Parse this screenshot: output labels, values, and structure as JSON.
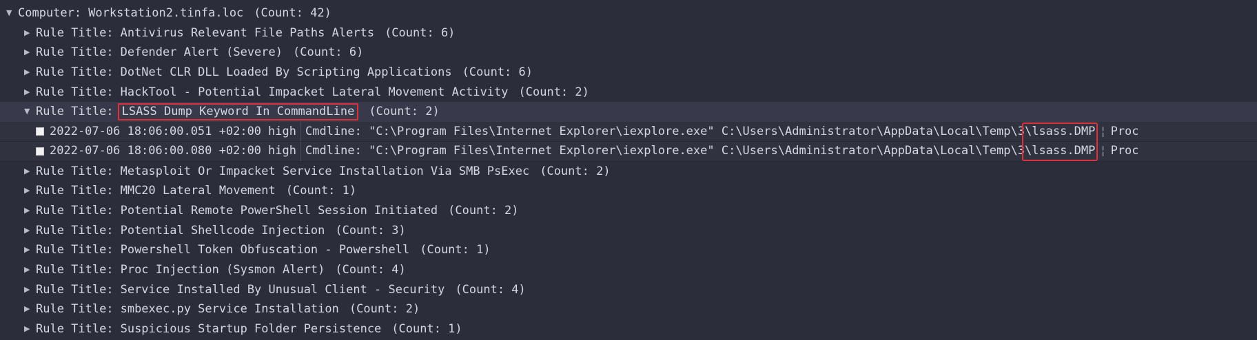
{
  "root": {
    "prefix": "Computer:",
    "name": "Workstation2.tinfa.loc",
    "count": "(Count: 42)"
  },
  "rule_prefix": "Rule Title:",
  "rules_before": [
    {
      "title": "Antivirus Relevant File Paths Alerts",
      "count": "(Count: 6)"
    },
    {
      "title": "Defender Alert (Severe)",
      "count": "(Count: 6)"
    },
    {
      "title": "DotNet CLR DLL Loaded By Scripting Applications",
      "count": "(Count: 6)"
    },
    {
      "title": "HackTool - Potential Impacket Lateral Movement Activity",
      "count": "(Count: 2)"
    }
  ],
  "expanded_rule": {
    "title": "LSASS Dump Keyword In CommandLine",
    "count": "(Count: 2)"
  },
  "events": [
    {
      "timestamp": "2022-07-06 18:06:00.051 +02:00",
      "level": "high",
      "cmdline_prefix": "Cmdline: \"C:\\Program Files\\Internet Explorer\\iexplore.exe\" C:\\Users\\Administrator\\AppData\\Local\\Temp\\3",
      "cmdline_highlight": "\\lsass.DMP",
      "separator": "¦",
      "trailing": "Proc"
    },
    {
      "timestamp": "2022-07-06 18:06:00.080 +02:00",
      "level": "high",
      "cmdline_prefix": "Cmdline: \"C:\\Program Files\\Internet Explorer\\iexplore.exe\" C:\\Users\\Administrator\\AppData\\Local\\Temp\\3",
      "cmdline_highlight": "\\lsass.DMP",
      "separator": "¦",
      "trailing": "Proc"
    }
  ],
  "rules_after": [
    {
      "title": "Metasploit Or Impacket Service Installation Via SMB PsExec",
      "count": "(Count: 2)"
    },
    {
      "title": "MMC20 Lateral Movement",
      "count": "(Count: 1)"
    },
    {
      "title": "Potential Remote PowerShell Session Initiated",
      "count": "(Count: 2)"
    },
    {
      "title": "Potential Shellcode Injection",
      "count": "(Count: 3)"
    },
    {
      "title": "Powershell Token Obfuscation - Powershell",
      "count": "(Count: 1)"
    },
    {
      "title": "Proc Injection (Sysmon Alert)",
      "count": "(Count: 4)"
    },
    {
      "title": "Service Installed By Unusual Client - Security",
      "count": "(Count: 4)"
    },
    {
      "title": "smbexec.py Service Installation",
      "count": "(Count: 2)"
    },
    {
      "title": "Suspicious Startup Folder Persistence",
      "count": "(Count: 1)"
    }
  ],
  "icons": {
    "expanded": "caret-down-icon",
    "collapsed": "caret-right-icon"
  },
  "colors": {
    "background": "#2b2d3a",
    "text": "#d4d6e0",
    "highlight_border": "#e0323a"
  }
}
